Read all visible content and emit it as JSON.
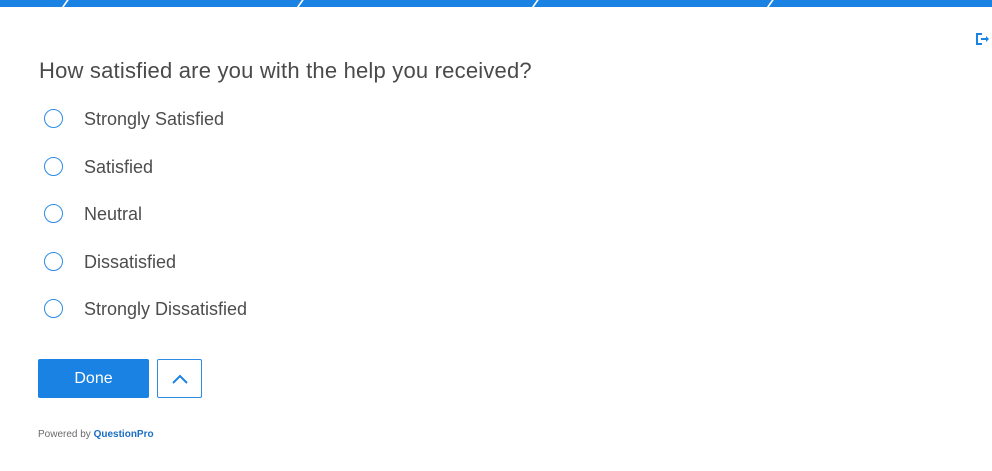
{
  "survey": {
    "question": "How satisfied are you with the help you received?",
    "options": [
      {
        "label": "Strongly Satisfied",
        "selected": false
      },
      {
        "label": "Satisfied",
        "selected": false
      },
      {
        "label": "Neutral",
        "selected": false
      },
      {
        "label": "Dissatisfied",
        "selected": false
      },
      {
        "label": "Strongly Dissatisfied",
        "selected": false
      }
    ]
  },
  "actions": {
    "done_label": "Done",
    "up_icon": "chevron-up-icon",
    "exit_icon": "exit-icon"
  },
  "footer": {
    "powered_by": "Powered by",
    "brand": "QuestionPro"
  },
  "colors": {
    "accent": "#1a82e2",
    "text": "#4a4a4a",
    "background": "#ffffff"
  }
}
